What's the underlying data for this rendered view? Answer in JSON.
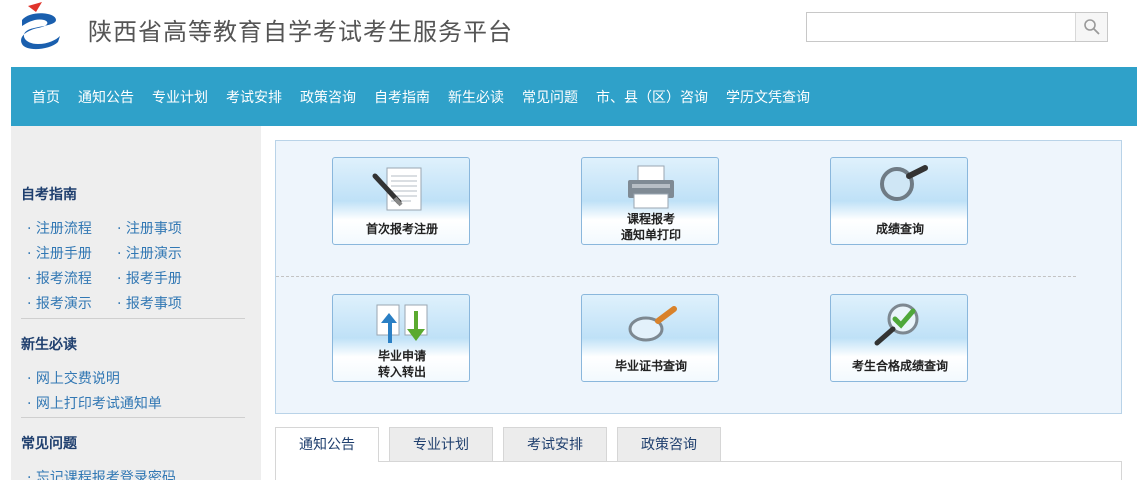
{
  "header": {
    "site_title": "陕西省高等教育自学考试考生服务平台",
    "search_value": "",
    "logo_icon": "exam-logo-icon",
    "search_icon": "search-icon"
  },
  "nav": {
    "items": [
      "首页",
      "通知公告",
      "专业计划",
      "考试安排",
      "政策咨询",
      "自考指南",
      "新生必读",
      "常见问题",
      "市、县（区）咨询",
      "学历文凭查询"
    ]
  },
  "sidebar": {
    "section1": {
      "title": "自考指南",
      "rows": [
        [
          "· 注册流程",
          "· 注册事项"
        ],
        [
          "· 注册手册",
          "· 注册演示"
        ],
        [
          "· 报考流程",
          "· 报考手册"
        ],
        [
          "· 报考演示",
          "· 报考事项"
        ]
      ]
    },
    "section2": {
      "title": "新生必读",
      "items": [
        "· 网上交费说明",
        "· 网上打印考试通知单"
      ]
    },
    "section3": {
      "title": "常见问题",
      "items": [
        "· 忘记课程报考登录密码"
      ]
    }
  },
  "services": {
    "first_registration": "首次报考注册",
    "course_print_line1": "课程报考",
    "course_print_line2": "通知单打印",
    "score_query": "成绩查询",
    "transfer_line1": "毕业申请",
    "transfer_line2": "转入转出",
    "certificate_query": "毕业证书查询",
    "qualified_score_query": "考生合格成绩查询"
  },
  "tabs": {
    "items": [
      "通知公告",
      "专业计划",
      "考试安排",
      "政策咨询"
    ],
    "active": 0
  },
  "colors": {
    "nav_bg": "#2fa1c9",
    "sidebar_bg": "#eeeeee",
    "panel_bg": "#eef5fc",
    "link": "#3278b4",
    "title": "#1f3f6e"
  }
}
